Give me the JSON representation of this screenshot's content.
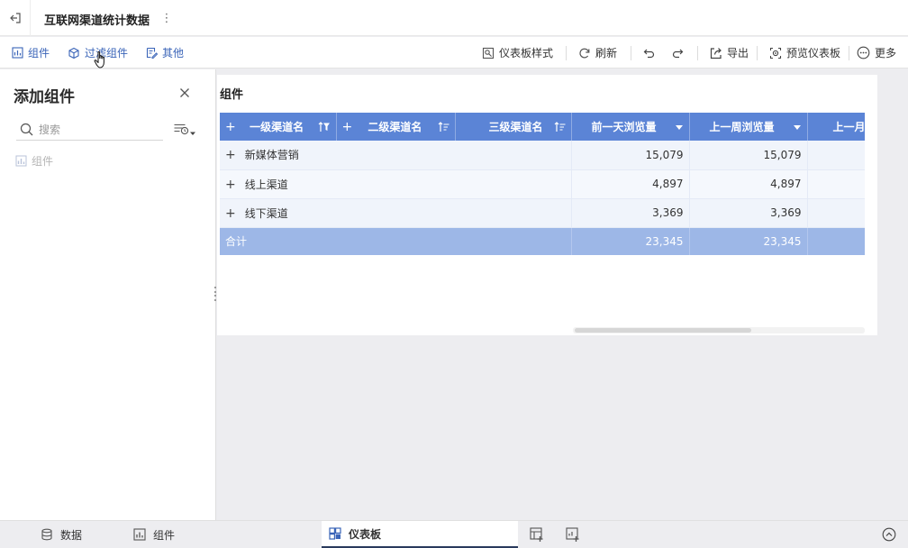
{
  "header": {
    "title": "互联网渠道统计数据"
  },
  "toolbar": {
    "component": "组件",
    "filter_component": "过滤组件",
    "other": "其他",
    "dashboard_style": "仪表板样式",
    "refresh": "刷新",
    "export": "导出",
    "preview": "预览仪表板",
    "more": "更多"
  },
  "panel": {
    "title": "添加组件",
    "search_placeholder": "搜索",
    "item": "组件"
  },
  "widget": {
    "title": "组件",
    "columns": {
      "c1": "一级渠道名",
      "c2": "二级渠道名",
      "c3": "三级渠道名",
      "c4": "前一天浏览量",
      "c5": "上一周浏览量",
      "c6": "上一月"
    },
    "rows": [
      {
        "name": "新媒体营销",
        "prev_day": "15,079",
        "prev_week": "15,079"
      },
      {
        "name": "线上渠道",
        "prev_day": "4,897",
        "prev_week": "4,897"
      },
      {
        "name": "线下渠道",
        "prev_day": "3,369",
        "prev_week": "3,369"
      }
    ],
    "total": {
      "label": "合计",
      "prev_day": "23,345",
      "prev_week": "23,345"
    }
  },
  "bottom": {
    "data": "数据",
    "component": "组件",
    "dashboard": "仪表板"
  },
  "colors": {
    "header_blue": "#5b84d6",
    "total_blue": "#9db7e7",
    "accent": "#3a64b8"
  }
}
